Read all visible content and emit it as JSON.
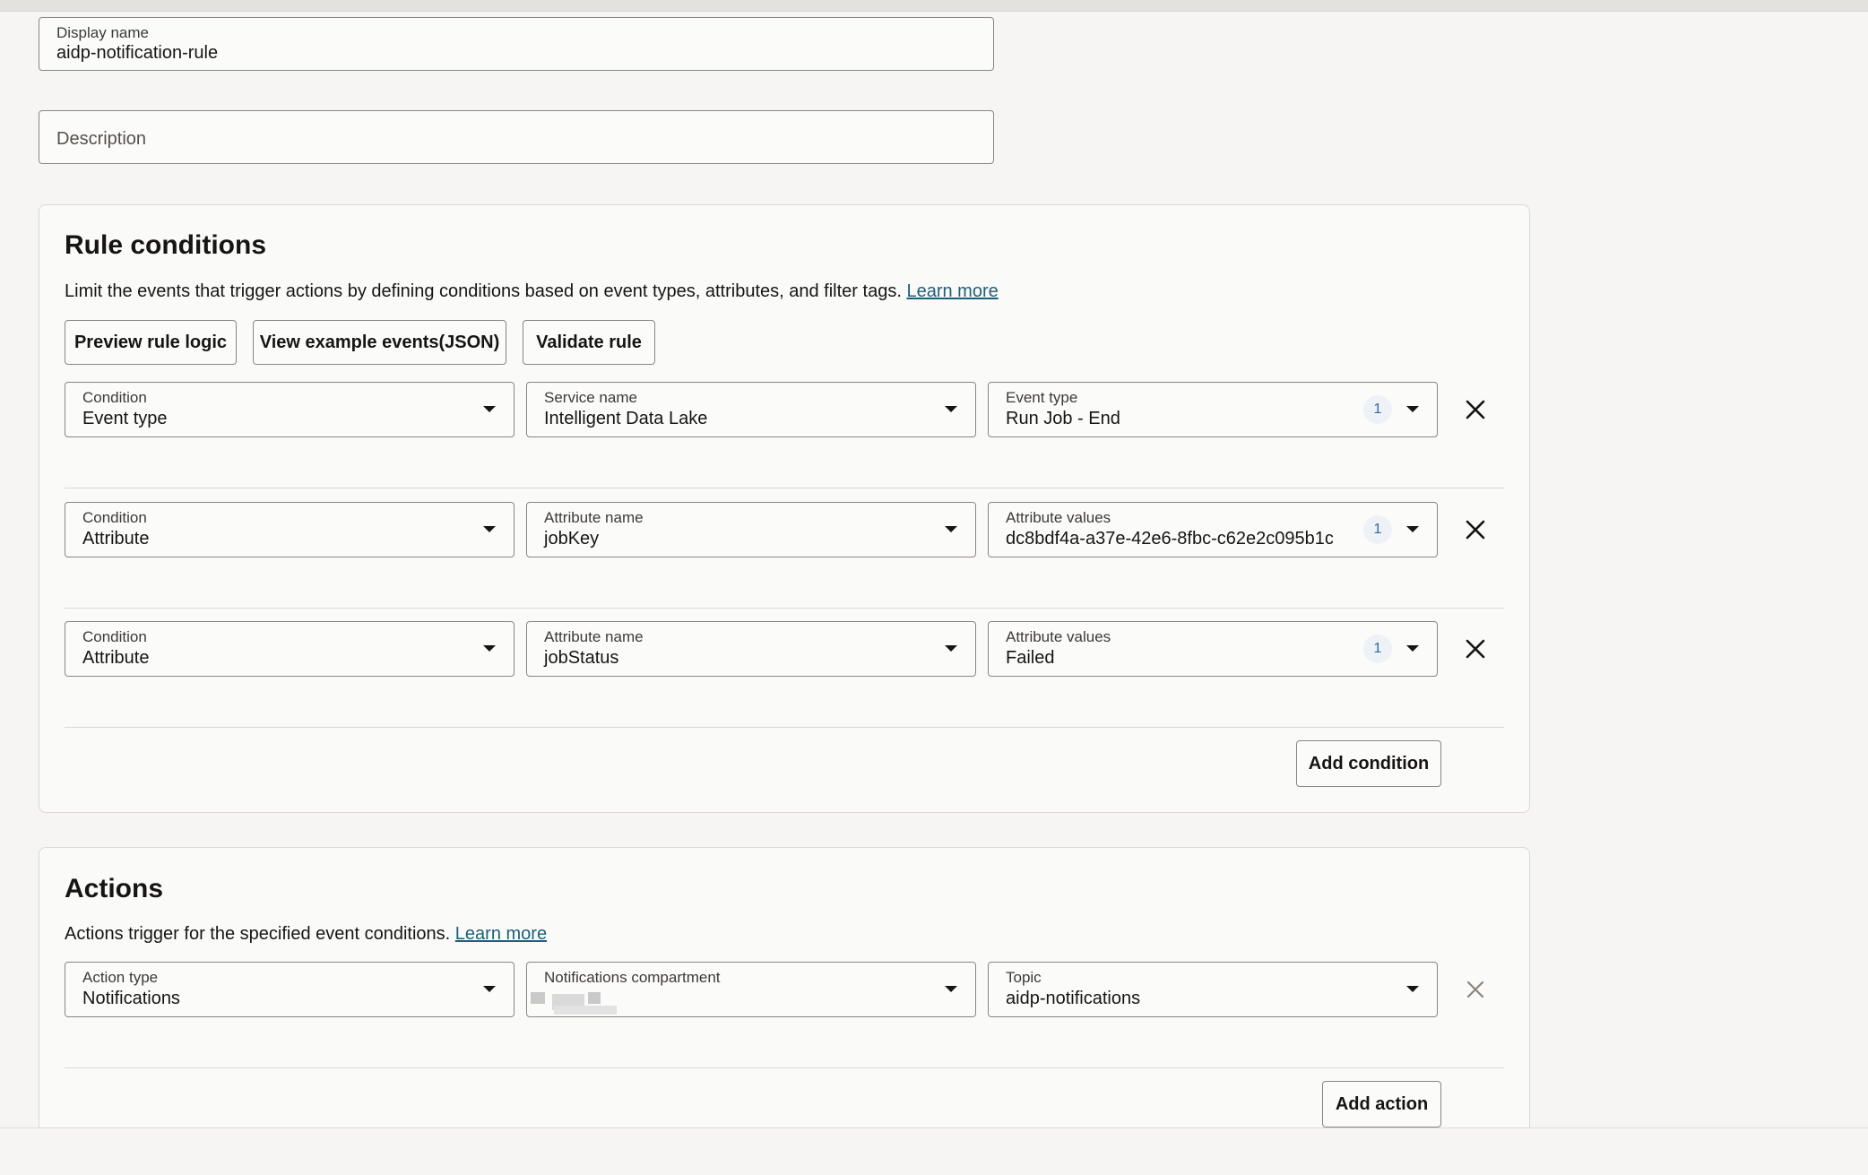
{
  "form": {
    "display_name": {
      "label": "Display name",
      "value": "aidp-notification-rule"
    },
    "description": {
      "placeholder": "Description"
    }
  },
  "rule_conditions": {
    "title": "Rule conditions",
    "description": "Limit the events that trigger actions by defining conditions based on event types, attributes, and filter tags.",
    "learn_more": "Learn more",
    "buttons": {
      "preview": "Preview rule logic",
      "view_examples": "View example events(JSON)",
      "validate": "Validate rule"
    },
    "rows": [
      {
        "condition": {
          "label": "Condition",
          "value": "Event type"
        },
        "second": {
          "label": "Service name",
          "value": "Intelligent Data Lake"
        },
        "third": {
          "label": "Event type",
          "value": "Run Job - End",
          "count": "1"
        }
      },
      {
        "condition": {
          "label": "Condition",
          "value": "Attribute"
        },
        "second": {
          "label": "Attribute name",
          "value": "jobKey"
        },
        "third": {
          "label": "Attribute values",
          "value": "dc8bdf4a-a37e-42e6-8fbc-c62e2c095b1c",
          "count": "1"
        }
      },
      {
        "condition": {
          "label": "Condition",
          "value": "Attribute"
        },
        "second": {
          "label": "Attribute name",
          "value": "jobStatus"
        },
        "third": {
          "label": "Attribute values",
          "value": "Failed",
          "count": "1"
        }
      }
    ],
    "add_condition": "Add condition"
  },
  "actions": {
    "title": "Actions",
    "description": "Actions trigger for the specified event conditions.",
    "learn_more": "Learn more",
    "row": {
      "action_type": {
        "label": "Action type",
        "value": "Notifications"
      },
      "compartment": {
        "label": "Notifications compartment",
        "value": ""
      },
      "topic": {
        "label": "Topic",
        "value": "aidp-notifications"
      }
    },
    "add_action": "Add action"
  },
  "icons": {
    "dropdown": "chevron-down-icon",
    "remove": "close-icon"
  },
  "colors": {
    "link": "#1e5f7a",
    "count_badge": "#2b6b9a",
    "border": "#8b8580"
  }
}
